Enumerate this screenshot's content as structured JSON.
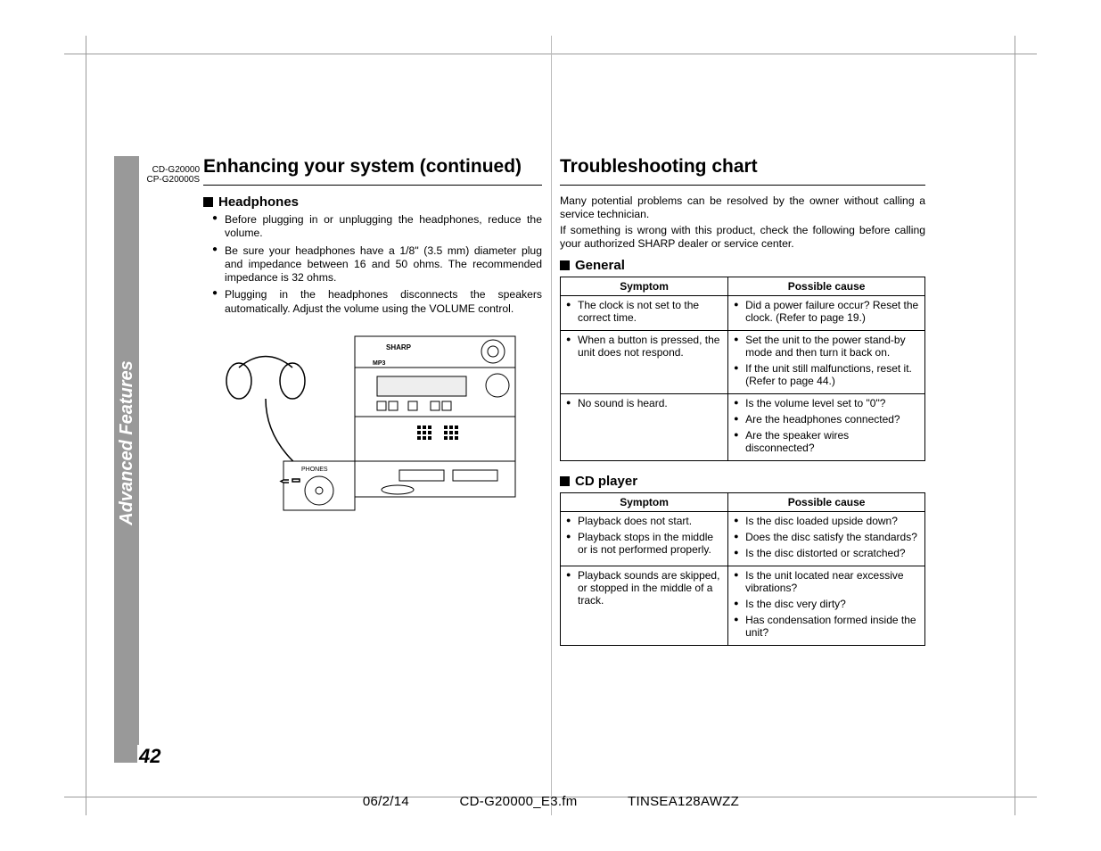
{
  "side_tab": "Advanced Features",
  "page_number": "42",
  "model_lines": "CD-G20000\nCP-G20000S",
  "left": {
    "title": "Enhancing your system (continued)",
    "h_headphones": "Headphones",
    "bullets": [
      "Before plugging in or unplugging the headphones, reduce the volume.",
      "Be sure your headphones have a 1/8\" (3.5 mm) diameter plug and impedance between 16 and 50 ohms. The recommended impedance is 32 ohms.",
      "Plugging in the headphones disconnects the speakers automatically. Adjust the volume using the VOLUME control."
    ],
    "diagram_labels": {
      "brand": "SHARP",
      "jack": "PHONES",
      "format": "MP3"
    }
  },
  "right": {
    "title": "Troubleshooting chart",
    "intro1": "Many potential problems can be resolved by the owner without calling a service technician.",
    "intro2": "If something is wrong with this product, check the following before calling your authorized SHARP dealer or service center.",
    "h_general": "General",
    "h_cd": "CD player",
    "th_symptom": "Symptom",
    "th_cause": "Possible cause",
    "general_rows": [
      {
        "symptom": "The clock is not set to the correct time.",
        "causes": [
          "Did a power failure occur? Reset the clock. (Refer to page 19.)"
        ]
      },
      {
        "symptom": "When a button is pressed, the unit does not respond.",
        "causes": [
          "Set the unit to the power stand-by mode and then turn it back on.",
          "If the unit still malfunctions, reset it. (Refer to page 44.)"
        ]
      },
      {
        "symptom": "No sound is heard.",
        "causes": [
          "Is the volume level set to \"0\"?",
          "Are the headphones connected?",
          "Are the speaker wires disconnected?"
        ]
      }
    ],
    "cd_rows": [
      {
        "symptom": "Playback does not start.\nPlayback stops in the middle or is not performed properly.",
        "causes": [
          "Is the disc loaded upside down?",
          "Does the disc satisfy the standards?",
          "Is the disc distorted or scratched?"
        ]
      },
      {
        "symptom": "Playback sounds are skipped, or stopped in the middle of a track.",
        "causes": [
          "Is the unit located near excessive vibrations?",
          "Is the disc very dirty?",
          "Has condensation formed inside the unit?"
        ]
      }
    ]
  },
  "footer": {
    "date": "06/2/14",
    "file": "CD-G20000_E3.fm",
    "code": "TINSEA128AWZZ"
  }
}
